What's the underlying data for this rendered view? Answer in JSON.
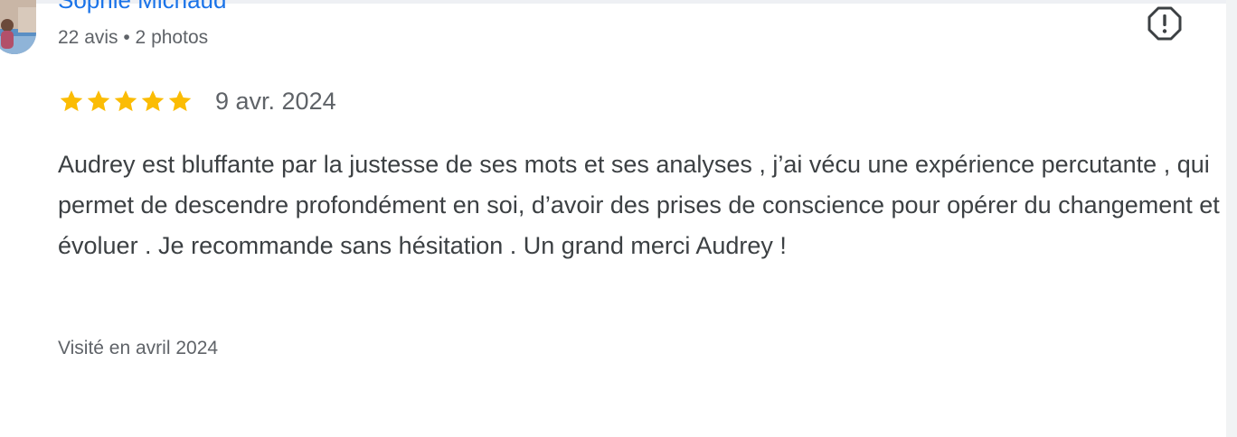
{
  "review": {
    "reviewer_name": "Sophie Michaud",
    "reviewer_meta": "22 avis • 2 photos",
    "rating": 5,
    "rating_max": 5,
    "date": "9 avr. 2024",
    "text": "Audrey est bluffante par la justesse de ses mots et ses analyses , j’ai vécu une expérience percutante , qui permet de descendre profondément en soi, d’avoir des prises de conscience pour opérer du changement et évoluer . Je recommande sans hésitation . Un grand merci Audrey !",
    "visit_info": "Visité en avril 2024"
  },
  "icons": {
    "report": "report-flag-icon",
    "star": "star-icon"
  },
  "colors": {
    "name": "#1a73e8",
    "star": "#fbbc04",
    "text": "#3c4043",
    "muted": "#5f6368"
  }
}
